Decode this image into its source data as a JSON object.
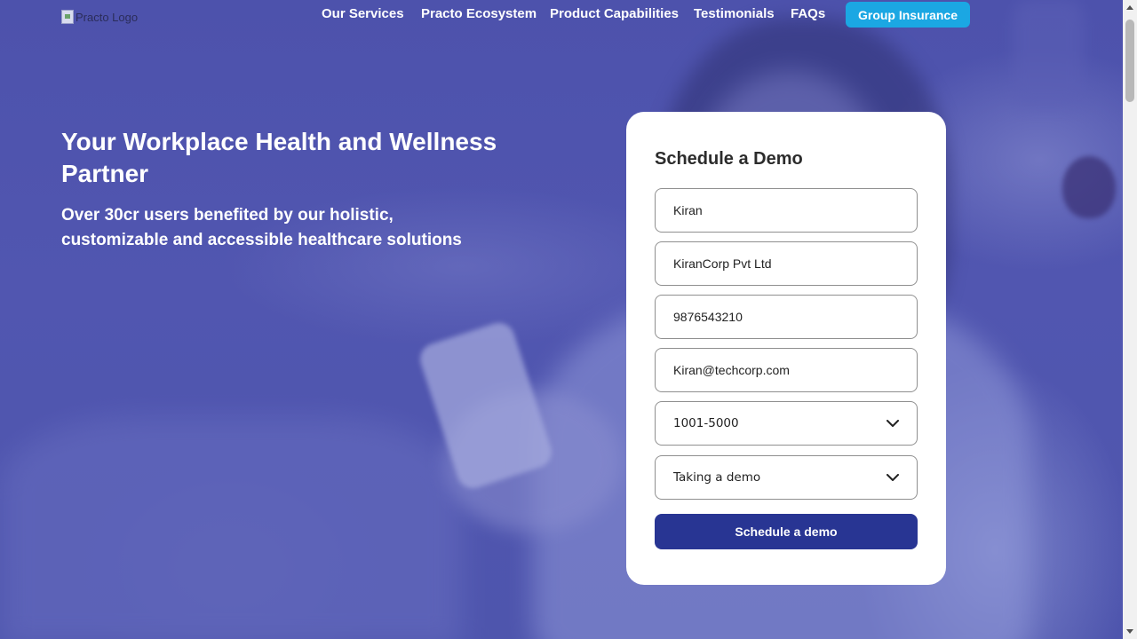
{
  "header": {
    "logo_alt": "Practo Logo",
    "nav": [
      {
        "label": "Our Services"
      },
      {
        "label": "Practo Ecosystem"
      },
      {
        "label": "Product Capabilities"
      },
      {
        "label": "Testimonials"
      },
      {
        "label": "FAQs"
      }
    ],
    "cta_label": "Group Insurance"
  },
  "hero": {
    "title": "Your Workplace Health and Wellness Partner",
    "subtitle": "Over 30cr users benefited by our holistic, customizable and accessible healthcare solutions"
  },
  "form": {
    "title": "Schedule a Demo",
    "name_value": "Kiran",
    "company_value": "KiranCorp Pvt Ltd",
    "phone_value": "9876543210",
    "email_value": "Kiran@techcorp.com",
    "company_size_value": "1001-5000",
    "interest_value": "Taking a demo",
    "submit_label": "Schedule a demo"
  },
  "colors": {
    "hero_overlay": "#4d52ac",
    "cta_button": "#1ba7e3",
    "submit_button": "#283593",
    "card_background": "#ffffff"
  },
  "icons": {
    "dropdown": "chevron-down-icon",
    "logo_placeholder": "broken-image-icon"
  }
}
